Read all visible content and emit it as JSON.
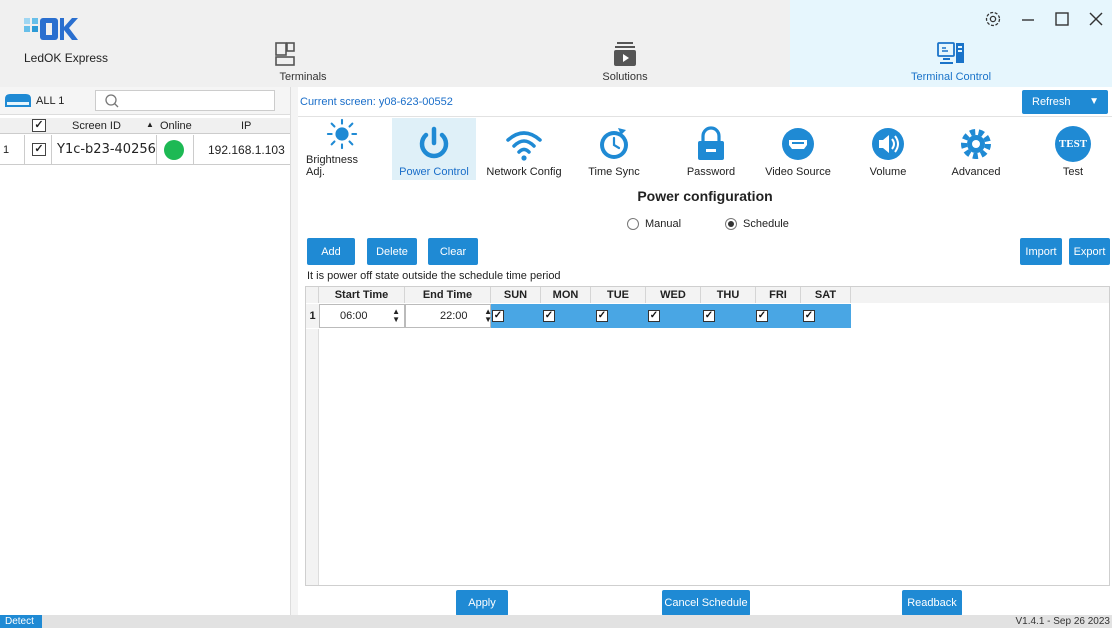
{
  "app": {
    "logo_text": "OK",
    "name": "LedOK Express",
    "window_controls": [
      "settings-icon",
      "minimize-icon",
      "maximize-icon",
      "close-icon"
    ]
  },
  "nav": [
    {
      "label": "Terminals",
      "icon": "terminals-icon"
    },
    {
      "label": "Solutions",
      "icon": "solutions-icon"
    },
    {
      "label": "Terminal Control",
      "icon": "terminal-control-icon",
      "active": true
    }
  ],
  "left_panel": {
    "group_label": "ALL 1",
    "search_placeholder": "",
    "columns": [
      "Screen ID",
      "Online",
      "IP"
    ],
    "rows": [
      {
        "index": "1",
        "checked": "✓",
        "screen_id": "Y1c-b23-40256",
        "online_color": "#1db954",
        "ip": "192.168.1.103"
      }
    ],
    "header_check": "✓"
  },
  "current_screen": "Current screen: y08-623-00552",
  "refresh_label": "Refresh",
  "functions": [
    {
      "label": "Brightness Adj.",
      "icon": "sun-icon"
    },
    {
      "label": "Power Control",
      "icon": "power-icon",
      "active": true
    },
    {
      "label": "Network Config",
      "icon": "wifi-icon"
    },
    {
      "label": "Time Sync",
      "icon": "clock-icon"
    },
    {
      "label": "Password",
      "icon": "lock-icon"
    },
    {
      "label": "Video Source",
      "icon": "hdmi-icon"
    },
    {
      "label": "Volume",
      "icon": "speaker-icon"
    },
    {
      "label": "Advanced",
      "icon": "gear-icon"
    },
    {
      "label": "Test",
      "icon": "test-icon",
      "badge": "TEST"
    }
  ],
  "power": {
    "title": "Power configuration",
    "mode_manual": "Manual",
    "mode_schedule": "Schedule",
    "selected_mode": "Schedule",
    "buttons": {
      "add": "Add",
      "delete": "Delete",
      "clear": "Clear",
      "import": "Import",
      "export": "Export"
    },
    "note": "It is power off state outside the schedule time period",
    "columns": [
      "Start Time",
      "End Time",
      "SUN",
      "MON",
      "TUE",
      "WED",
      "THU",
      "FRI",
      "SAT"
    ],
    "rows": [
      {
        "index": "1",
        "start": "06:00",
        "end": "22:00",
        "days": [
          "✓",
          "✓",
          "✓",
          "✓",
          "✓",
          "✓",
          "✓"
        ]
      }
    ],
    "actions": {
      "apply": "Apply",
      "cancel_schedule": "Cancel Schedule",
      "readback": "Readback"
    }
  },
  "status": {
    "detect": "Detect",
    "version": "V1.4.1 - Sep 26 2023"
  },
  "colors": {
    "accent": "#1f8ad4",
    "row_selected": "#49a6e4",
    "online": "#1db954"
  }
}
